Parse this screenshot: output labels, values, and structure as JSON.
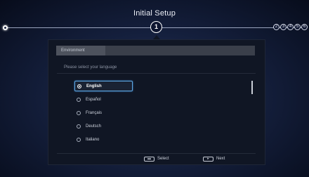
{
  "header": {
    "title": "Initial Setup",
    "current_step": "1",
    "remaining_steps": [
      "2",
      "3",
      "4",
      "5",
      "6"
    ]
  },
  "panel": {
    "tab_label": "Environment",
    "prompt": "Please select your language",
    "languages": [
      {
        "label": "English",
        "selected": true
      },
      {
        "label": "Español",
        "selected": false
      },
      {
        "label": "Français",
        "selected": false
      },
      {
        "label": "Deutsch",
        "selected": false
      },
      {
        "label": "Italiano",
        "selected": false
      }
    ]
  },
  "footer": {
    "select_label": "Select",
    "next_label": "Next"
  },
  "colors": {
    "accent": "#5fa8e4",
    "panel_bg": "#101624"
  }
}
